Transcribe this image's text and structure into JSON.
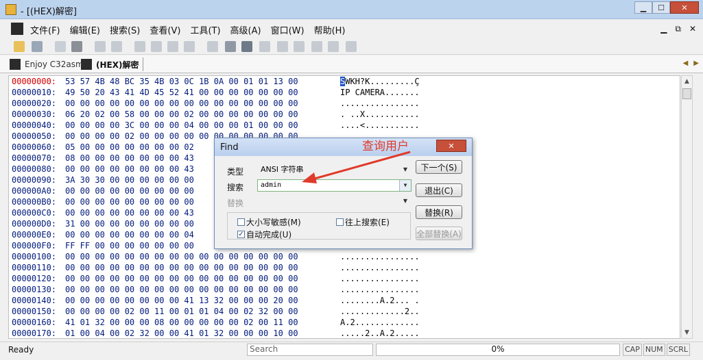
{
  "window": {
    "title": "- [(HEX)解密]"
  },
  "menu": {
    "items": [
      "文件(F)",
      "编辑(E)",
      "搜索(S)",
      "查看(V)",
      "工具(T)",
      "高级(A)",
      "窗口(W)",
      "帮助(H)"
    ]
  },
  "tabs": [
    {
      "label": "Enjoy C32asm"
    },
    {
      "label": "(HEX)解密"
    }
  ],
  "hex_rows": [
    {
      "addr": "00000000:",
      "bytes": "53 57 4B 48 BC 35 4B 03 0C 1B 0A 00 01 01 13 00",
      "ascii_head": "S",
      "ascii": "WKH?K.........Ç"
    },
    {
      "addr": "00000010:",
      "bytes": "49 50 20 43 41 4D 45 52 41 00 00 00 00 00 00 00",
      "ascii_head": "",
      "ascii": "IP CAMERA......."
    },
    {
      "addr": "00000020:",
      "bytes": "00 00 00 00 00 00 00 00 00 00 00 00 00 00 00 00",
      "ascii_head": "",
      "ascii": "................"
    },
    {
      "addr": "00000030:",
      "bytes": "06 20 02 00 58 00 00 00 02 00 00 00 00 00 00 00",
      "ascii_head": "",
      "ascii": ". ..X..........."
    },
    {
      "addr": "00000040:",
      "bytes": "00 00 00 00 3C 00 00 00 04 00 00 00 01 00 00 00",
      "ascii_head": "",
      "ascii": "....<..........."
    },
    {
      "addr": "00000050:",
      "bytes": "00 00 00 00 02 00 00 00 00 00 00 00 00 00 00 00",
      "ascii_head": "",
      "ascii": "................"
    },
    {
      "addr": "00000060:",
      "bytes": "05 00 00 00 00 00 00 00 02",
      "ascii_head": "",
      "ascii": ""
    },
    {
      "addr": "00000070:",
      "bytes": "08 00 00 00 00 00 00 00 43",
      "ascii_head": "",
      "ascii": ""
    },
    {
      "addr": "00000080:",
      "bytes": "00 00 00 00 00 00 00 00 43",
      "ascii_head": "",
      "ascii": ""
    },
    {
      "addr": "00000090:",
      "bytes": "3A 30 30 00 00 00 00 00 00",
      "ascii_head": "",
      "ascii": ""
    },
    {
      "addr": "000000A0:",
      "bytes": "00 00 00 00 00 00 00 00 00",
      "ascii_head": "",
      "ascii": ""
    },
    {
      "addr": "000000B0:",
      "bytes": "00 00 00 00 00 00 00 00 00",
      "ascii_head": "",
      "ascii": ""
    },
    {
      "addr": "000000C0:",
      "bytes": "00 00 00 00 00 00 00 00 43",
      "ascii_head": "",
      "ascii": ""
    },
    {
      "addr": "000000D0:",
      "bytes": "31 00 00 00 00 00 00 00 00",
      "ascii_head": "",
      "ascii": ""
    },
    {
      "addr": "000000E0:",
      "bytes": "00 00 00 00 00 00 00 00 04",
      "ascii_head": "",
      "ascii": ""
    },
    {
      "addr": "000000F0:",
      "bytes": "FF FF 00 00 00 00 00 00 00",
      "ascii_head": "",
      "ascii": ""
    },
    {
      "addr": "00000100:",
      "bytes": "00 00 00 00 00 00 00 00 00 00 00 00 00 00 00 00",
      "ascii_head": "",
      "ascii": "................"
    },
    {
      "addr": "00000110:",
      "bytes": "00 00 00 00 00 00 00 00 00 00 00 00 00 00 00 00",
      "ascii_head": "",
      "ascii": "................"
    },
    {
      "addr": "00000120:",
      "bytes": "00 00 00 00 00 00 00 00 00 00 00 00 00 00 00 00",
      "ascii_head": "",
      "ascii": "................"
    },
    {
      "addr": "00000130:",
      "bytes": "00 00 00 00 00 00 00 00 00 00 00 00 00 00 00 00",
      "ascii_head": "",
      "ascii": "................"
    },
    {
      "addr": "00000140:",
      "bytes": "00 00 00 00 00 00 00 00 41 13 32 00 00 00 20 00",
      "ascii_head": "",
      "ascii": "........A.2... ."
    },
    {
      "addr": "00000150:",
      "bytes": "00 00 00 00 02 00 11 00 01 01 04 00 02 32 00 00",
      "ascii_head": "",
      "ascii": ".............2.."
    },
    {
      "addr": "00000160:",
      "bytes": "41 01 32 00 00 00 08 00 00 00 00 00 02 00 11 00",
      "ascii_head": "",
      "ascii": "A.2............."
    },
    {
      "addr": "00000170:",
      "bytes": "01 00 04 00 02 32 00 00 41 01 32 00 00 00 10 00",
      "ascii_head": "",
      "ascii": ".....2..A.2....."
    }
  ],
  "status": {
    "ready": "Ready",
    "search": "Search",
    "progress": "0%",
    "keys": [
      "CAP",
      "NUM",
      "SCRL"
    ]
  },
  "find_dialog": {
    "title": "Find",
    "type_label": "类型",
    "type_value": "ANSI 字符串",
    "search_label": "搜索",
    "search_value": "admin",
    "replace_label": "替换",
    "replace_value": "",
    "btn_next": "下一个(S)",
    "btn_exit": "退出(C)",
    "btn_replace": "替换(R)",
    "btn_replace_all": "全部替换(A)",
    "chk_case": "大小写敏感(M)",
    "chk_case_checked": false,
    "chk_up": "往上搜索(E)",
    "chk_up_checked": false,
    "chk_auto": "自动完成(U)",
    "chk_auto_checked": true
  },
  "annotation": {
    "text": "查询用户",
    "color": "#e03a2a"
  }
}
